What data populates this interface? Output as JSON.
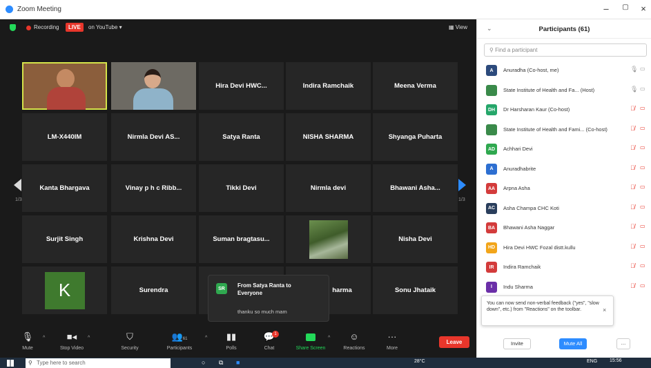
{
  "window": {
    "title": "Zoom Meeting",
    "controls": [
      "–",
      "▢",
      "×"
    ]
  },
  "meeting": {
    "recording_label": "Recording",
    "live_badge": "LIVE",
    "stream_label": "on YouTube ▾",
    "view_label": "View",
    "page_left": "1/3",
    "page_right": "1/3",
    "tiles": [
      [
        "",
        "",
        "Hira Devi HWC...",
        "Indira Ramchaik",
        "Meena Verma"
      ],
      [
        "LM-X440IM",
        "Nirmla Devi AS...",
        "Satya Ranta",
        "NISHA SHARMA",
        "Shyanga Puharta"
      ],
      [
        "Kanta Bhargava",
        "Vinay p h c Ribb...",
        "Tikki Devi",
        "Nirmla devi",
        "Bhawani  Asha..."
      ],
      [
        "Surjit Singh",
        "Krishna Devi",
        "Suman  bragtasu...",
        "",
        "Nisha Devi"
      ],
      [
        "K",
        "Surendra",
        "",
        "harma",
        "Sonu Jhataik"
      ]
    ],
    "chat_popup": {
      "avatar": "SR",
      "from": "From Satya Ranta to Everyone",
      "message": "thanku so much mam"
    },
    "toolbar": {
      "mute": "Mute",
      "stop_video": "Stop Video",
      "security": "Security",
      "participants": "Participants",
      "participants_count": "61",
      "polls": "Polls",
      "chat": "Chat",
      "chat_badge": "1",
      "share_screen": "Share Screen",
      "reactions": "Reactions",
      "more": "More",
      "leave": "Leave"
    }
  },
  "participants_panel": {
    "title": "Participants (61)",
    "search_placeholder": "Find a participant",
    "items": [
      {
        "initials": "A",
        "name": "Anuradha (Co-host, me)",
        "color": "#2c4a7c",
        "muted": false
      },
      {
        "initials": "",
        "name": "State Institute of Health and Fa...  (Host)",
        "color": "#3a8a4a",
        "muted": false
      },
      {
        "initials": "DH",
        "name": "Dr Harsharan Kaur (Co-host)",
        "color": "#25a66a",
        "muted": true
      },
      {
        "initials": "",
        "name": "State Institute of Health and Fami... (Co-host)",
        "color": "#3a8a4a",
        "muted": true
      },
      {
        "initials": "AD",
        "name": "Achhari Devi",
        "color": "#2fa84f",
        "muted": true
      },
      {
        "initials": "A",
        "name": "Anuradhabrite",
        "color": "#2d6fd1",
        "muted": true
      },
      {
        "initials": "AA",
        "name": "Arpna Asha",
        "color": "#d33b3b",
        "muted": true
      },
      {
        "initials": "AC",
        "name": "Asha Champa CHC Koti",
        "color": "#2a3e5c",
        "muted": true
      },
      {
        "initials": "BA",
        "name": "Bhawani  Asha Naggar",
        "color": "#d33b3b",
        "muted": true
      },
      {
        "initials": "HD",
        "name": "Hira Devi HWC Fozal distt.kullu",
        "color": "#f2a51a",
        "muted": true
      },
      {
        "initials": "IR",
        "name": "Indira Ramchaik",
        "color": "#d33b3b",
        "muted": true
      },
      {
        "initials": "I",
        "name": "Indu Sharma",
        "color": "#6b2fa8",
        "muted": true
      }
    ],
    "tooltip": "You can now send non-verbal feedback (\"yes\", \"slow down\", etc.) from \"Reactions\" on the toolbar.",
    "invite": "Invite",
    "mute_all": "Mute All",
    "more": "..."
  },
  "taskbar": {
    "search_placeholder": "Type here to search",
    "temperature": "28°C",
    "language": "ENG",
    "time": "15:56"
  }
}
